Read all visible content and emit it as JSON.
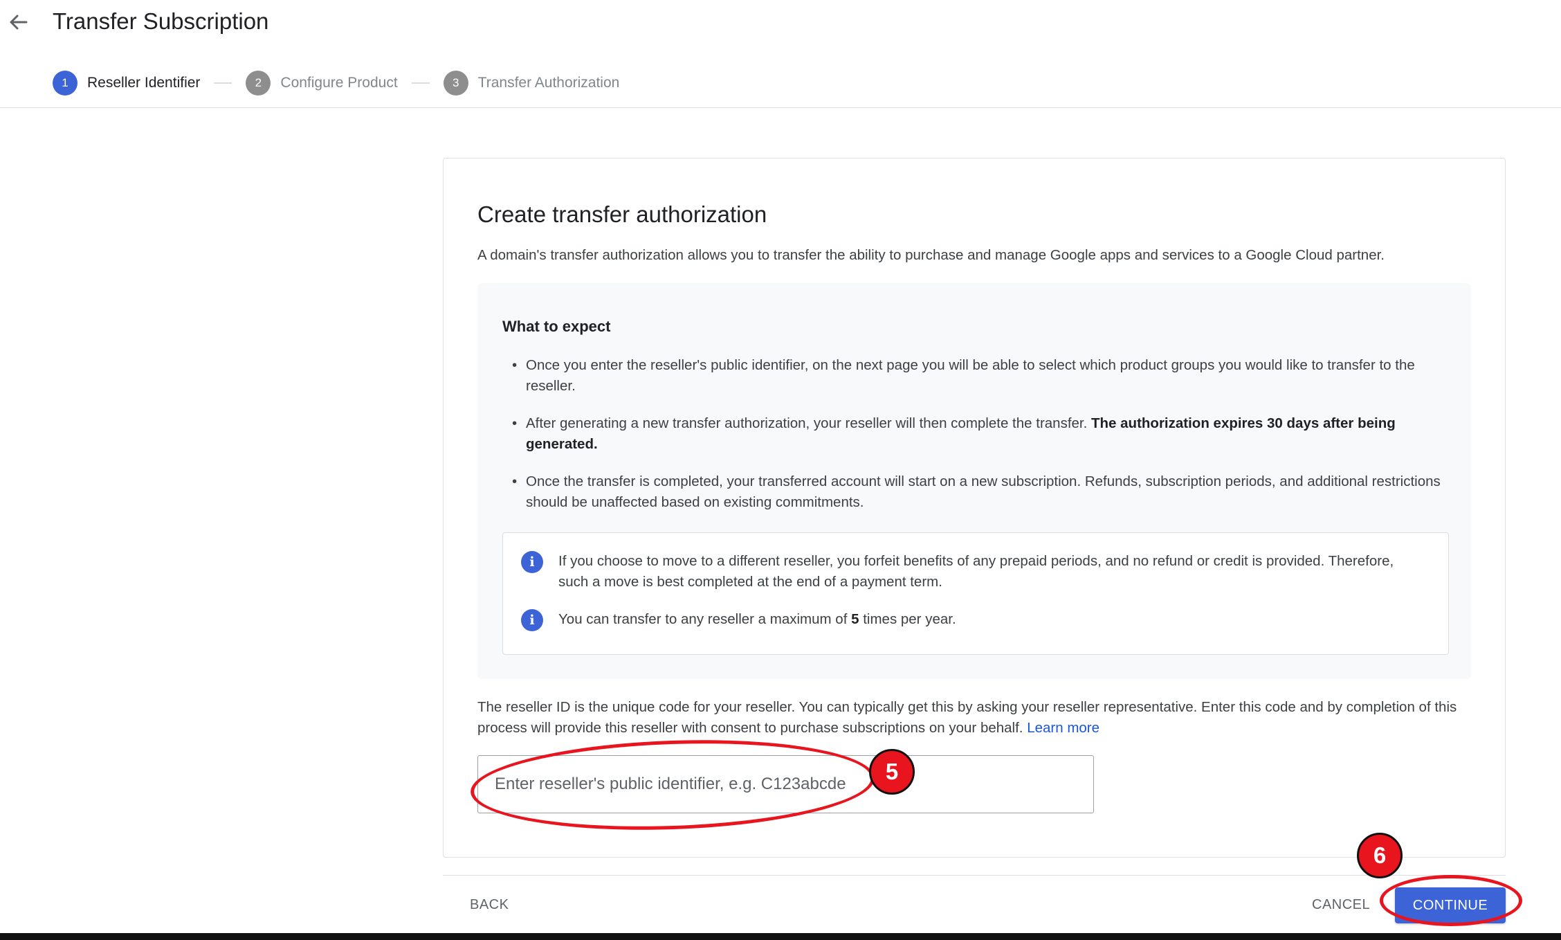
{
  "header": {
    "title": "Transfer Subscription",
    "back_icon": "arrow-left-icon"
  },
  "stepper": {
    "steps": [
      {
        "number": "1",
        "label": "Reseller Identifier",
        "state": "active"
      },
      {
        "number": "2",
        "label": "Configure Product",
        "state": "inactive"
      },
      {
        "number": "3",
        "label": "Transfer Authorization",
        "state": "inactive"
      }
    ]
  },
  "card": {
    "title": "Create transfer authorization",
    "description": "A domain's transfer authorization allows you to transfer the ability to purchase and manage Google apps and services to a Google Cloud partner.",
    "expect": {
      "title": "What to expect",
      "bullet1": "Once you enter the reseller's public identifier, on the next page you will be able to select which product groups you would like to transfer to the reseller.",
      "bullet2_text": "After generating a new transfer authorization, your reseller will then complete the transfer. ",
      "bullet2_bold": "The authorization expires 30 days after being generated.",
      "bullet3": "Once the transfer is completed, your transferred account will start on a new subscription. Refunds, subscription periods, and additional restrictions should be unaffected based on existing commitments."
    },
    "info": {
      "icon": "info-icon",
      "line1": "If you choose to move to a different reseller, you forfeit benefits of any prepaid periods, and no refund or credit is provided. Therefore, such a move is best completed at the end of a payment term.",
      "line2_prefix": "You can transfer to any reseller a maximum of ",
      "line2_bold": "5",
      "line2_suffix": " times per year."
    },
    "reseller_text": "The reseller ID is the unique code for your reseller. You can typically get this by asking your reseller representative. Enter this code and by completion of this process will provide this reseller with consent to purchase subscriptions on your behalf. ",
    "learn_more": "Learn more",
    "input": {
      "value": "",
      "placeholder": "Enter reseller's public identifier, e.g. C123abcde"
    }
  },
  "footer": {
    "back_label": "BACK",
    "cancel_label": "CANCEL",
    "continue_label": "CONTINUE"
  },
  "annotations": {
    "badge5": "5",
    "badge6": "6"
  },
  "colors": {
    "accent": "#3c64d6",
    "link": "#1a56db",
    "annotation": "#e8141e"
  }
}
